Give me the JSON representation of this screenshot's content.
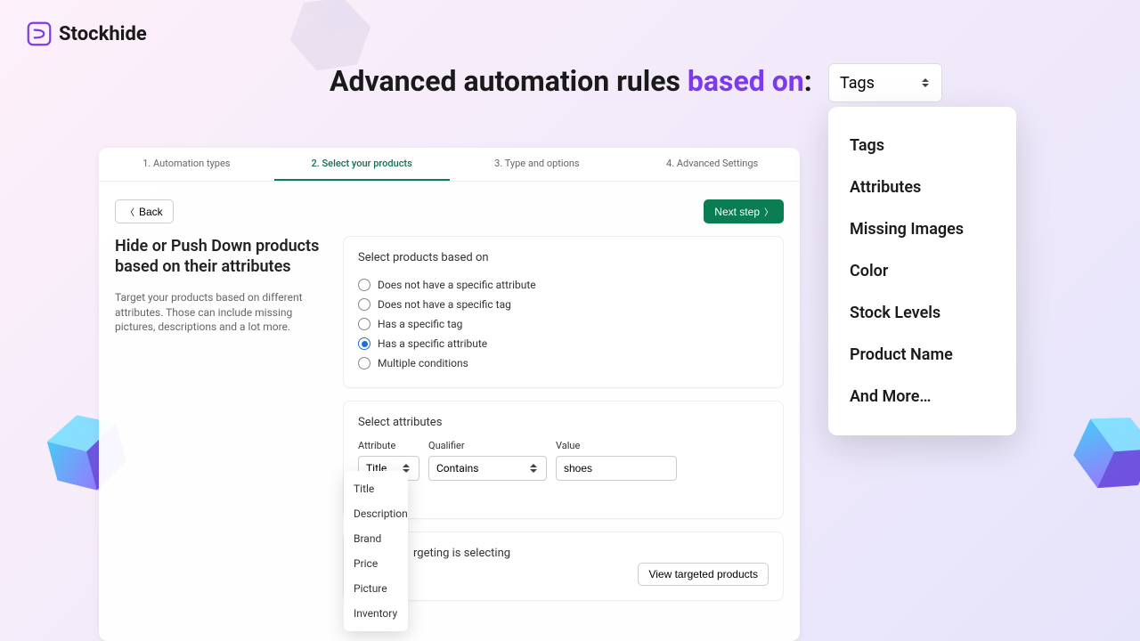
{
  "logo": {
    "text": "Stockhide"
  },
  "headline": {
    "part1": "Advanced automation rules ",
    "accent": "based on",
    "part3": ":"
  },
  "topSelect": {
    "value": "Tags"
  },
  "topMenu": {
    "items": [
      "Tags",
      "Attributes",
      "Missing Images",
      "Color",
      "Stock Levels",
      "Product Name",
      "And More…"
    ]
  },
  "tabs": {
    "t1": "1. Automation types",
    "t2": "2. Select your products",
    "t3": "3. Type and options",
    "t4": "4. Advanced Settings"
  },
  "toolbar": {
    "back": "Back",
    "next": "Next step"
  },
  "left": {
    "title": "Hide or Push Down products based on their attributes",
    "desc": "Target your products based on different attributes. Those can include missing pictures, descriptions and a lot more."
  },
  "basisCard": {
    "title": "Select products based on",
    "opts": [
      "Does not have a specific attribute",
      "Does not have a specific tag",
      "Has a specific tag",
      "Has a specific attribute",
      "Multiple conditions"
    ]
  },
  "attrCard": {
    "title": "Select attributes",
    "labels": {
      "attr": "Attribute",
      "qual": "Qualifier",
      "val": "Value"
    },
    "attr": "Title",
    "qual": "Contains",
    "val": "shoes",
    "dropdownItems": [
      "Title",
      "Description",
      "Brand",
      "Price",
      "Picture",
      "Inventory"
    ]
  },
  "targetCard": {
    "title": "rgeting is selecting",
    "btn": "View targeted products"
  }
}
